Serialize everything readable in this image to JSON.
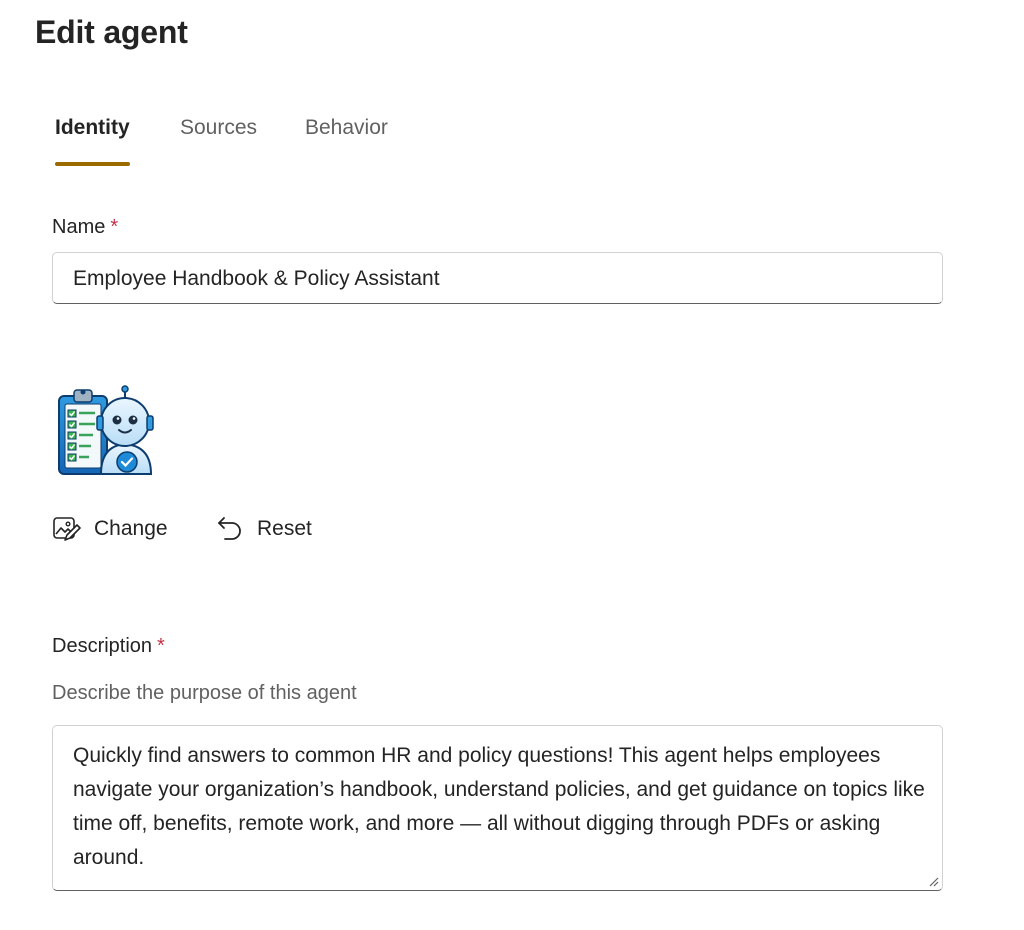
{
  "page": {
    "title": "Edit agent"
  },
  "tabs": [
    {
      "label": "Identity",
      "active": true
    },
    {
      "label": "Sources",
      "active": false
    },
    {
      "label": "Behavior",
      "active": false
    }
  ],
  "colors": {
    "accent": "#9a6b00",
    "required": "#c4314b",
    "text": "#242424",
    "muted": "#616161"
  },
  "name_field": {
    "label": "Name",
    "required_mark": "*",
    "value": "Employee Handbook & Policy Assistant"
  },
  "icon_actions": {
    "change_label": "Change",
    "change_icon": "image-edit-icon",
    "reset_label": "Reset",
    "reset_icon": "undo-arrow-icon"
  },
  "description_field": {
    "label": "Description",
    "required_mark": "*",
    "hint": "Describe the purpose of this agent",
    "value": "Quickly find answers to common HR and policy questions! This agent helps employees navigate your organization’s handbook, understand policies, and get guidance on topics like time off, benefits, remote work, and more — all without digging through PDFs or asking around."
  }
}
